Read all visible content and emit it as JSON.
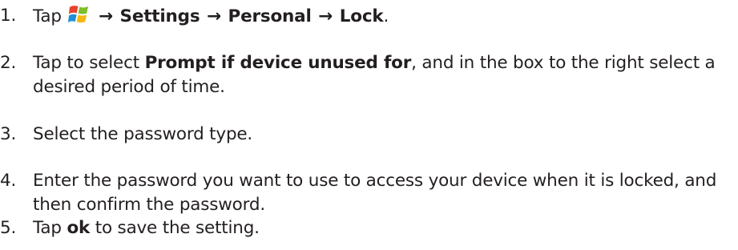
{
  "steps": [
    {
      "number": "1.",
      "tap": "Tap",
      "arrow": "→",
      "settings": "Settings",
      "personal": "Personal",
      "lock": "Lock",
      "period": "."
    },
    {
      "number": "2.",
      "pre": "Tap to select ",
      "bold": "Prompt if device unused for",
      "post": ", and in the box to the right select a desired period of time."
    },
    {
      "number": "3.",
      "text": "Select the password type."
    },
    {
      "number": "4.",
      "text": "Enter the password you want to use to access your device when it is locked, and then confirm the password."
    },
    {
      "number": "5.",
      "pre": "Tap ",
      "bold": "ok",
      "post": " to save the setting."
    }
  ],
  "icons": {
    "start": "windows-start-icon"
  }
}
